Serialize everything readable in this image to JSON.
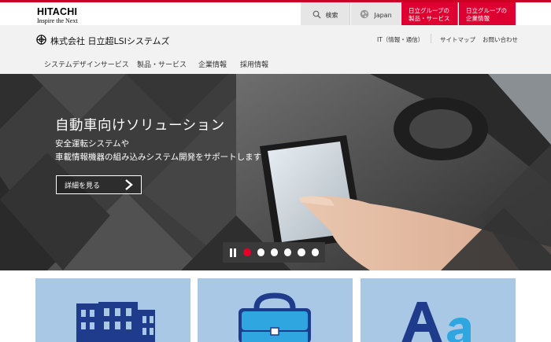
{
  "header": {
    "brand": "HITACHI",
    "tagline": "Inspire the Next",
    "search_label": "検索",
    "language_label": "Japan",
    "group_products": [
      "日立グループの",
      "製品・サービス"
    ],
    "group_corporate": [
      "日立グループの",
      "企業情報"
    ]
  },
  "company": {
    "name": "株式会社 日立超LSIシステムズ",
    "links": {
      "it": "IT（情報・通信）",
      "sitemap": "サイトマップ",
      "contact": "お問い合わせ"
    }
  },
  "global_nav": [
    "システムデザインサービス",
    "製品・サービス",
    "企業情報",
    "採用情報"
  ],
  "hero": {
    "title": "自動車向けソリューション",
    "subtitle_lines": [
      "安全運転システムや",
      "車載情報機器の組み込みシステム開発をサポートします"
    ],
    "button_label": "詳細を見る",
    "slide_count": 6,
    "active_slide": 1
  },
  "colors": {
    "brand_red": "#dd0030",
    "card_blue": "#a9c8e6",
    "icon_navy": "#1f3b8c"
  },
  "cards": [
    {
      "icon": "building-icon"
    },
    {
      "icon": "briefcase-icon"
    },
    {
      "icon": "text-font-icon"
    }
  ]
}
